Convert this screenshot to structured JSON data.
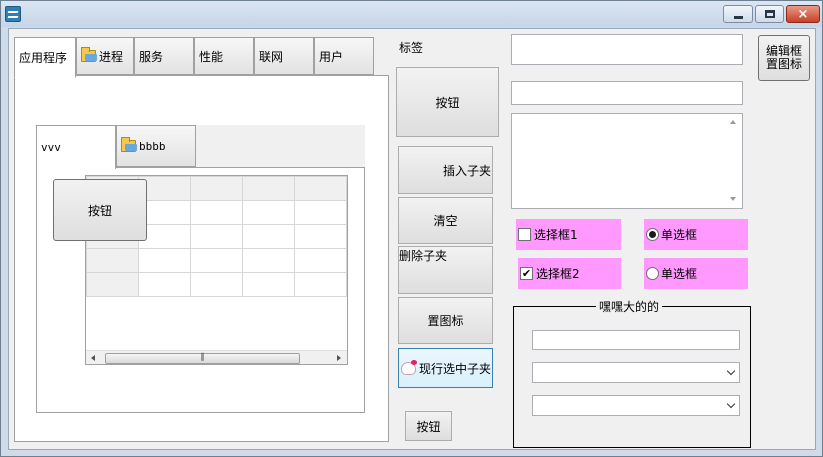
{
  "window": {
    "app_icon": "app-logo-icon",
    "caption_buttons": {
      "minimize": "minimize-icon",
      "maximize": "maximize-icon",
      "close": "close-icon",
      "close_glyph": "×"
    }
  },
  "tabs": [
    {
      "label": "应用程序",
      "icon": null,
      "active": true
    },
    {
      "label": "进程",
      "icon": "folder-icon",
      "active": false
    },
    {
      "label": "服务",
      "icon": null,
      "active": false
    },
    {
      "label": "性能",
      "icon": null,
      "active": false
    },
    {
      "label": "联网",
      "icon": null,
      "active": false
    },
    {
      "label": "用户",
      "icon": null,
      "active": false
    }
  ],
  "inner_tabs": [
    {
      "label": "vvv",
      "active": true
    },
    {
      "label": "bbbb",
      "icon": "folder-icon",
      "active": false
    }
  ],
  "panel_button": "按钮",
  "grid_scroll": {
    "thumb_grip": "⫼"
  },
  "middle": {
    "label": "标签",
    "button_big": "按钮",
    "insert_child": "插入子夹",
    "clear": "清空",
    "delete_child": "删除子夹",
    "set_icon": "置图标",
    "current_selected_child": "现行选中子夹",
    "button_small": "按钮"
  },
  "right": {
    "edit_frame_icon": "编辑框置图标",
    "checkbox1": {
      "label": "选择框1",
      "checked": false
    },
    "checkbox2": {
      "label": "选择框2",
      "checked": true,
      "mark": "✔"
    },
    "radio1": {
      "label": "单选框",
      "selected": true
    },
    "radio2": {
      "label": "单选框",
      "selected": false
    },
    "group_title": "嘿嘿大的的"
  },
  "colors": {
    "pink": "#ff99ff",
    "window_bg": "#f0f0f0",
    "frame": "#cfdbe8"
  }
}
